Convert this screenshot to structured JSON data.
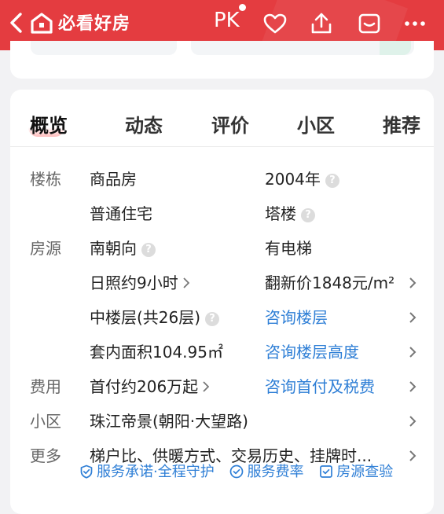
{
  "header": {
    "brand": "必看好房",
    "pk": "PK",
    "bg_color": "#e43c40",
    "icons": [
      "back-arrow-icon",
      "logo-house-icon",
      "heart-icon",
      "share-icon",
      "message-box-icon",
      "more-icon"
    ]
  },
  "tabs": [
    {
      "label": "概览",
      "active": true
    },
    {
      "label": "动态"
    },
    {
      "label": "评价"
    },
    {
      "label": "小区"
    },
    {
      "label": "推荐"
    }
  ],
  "rows": {
    "building_type": {
      "cat": "楼栋",
      "v1": "商品房",
      "v2": "2004年"
    },
    "building_usage": {
      "v1": "普通住宅",
      "v2": "塔楼"
    },
    "orientation": {
      "cat": "房源",
      "v1": "南朝向",
      "v2": "有电梯"
    },
    "sunlight": {
      "v1": "日照约9小时",
      "v2": "翻新价1848元/m²"
    },
    "floor": {
      "v1": "中楼层(共26层)",
      "v2": "咨询楼层"
    },
    "area": {
      "v1": "套内面积104.95㎡",
      "v2": "咨询楼层高度"
    },
    "fees": {
      "cat": "费用",
      "v1": "首付约206万起",
      "v2": "咨询首付及税费"
    },
    "community": {
      "cat": "小区",
      "v1": "珠江帝景(朝阳·大望路)"
    },
    "more": {
      "cat": "更多",
      "v1": "梯户比、供暖方式、交易历史、挂牌时..."
    }
  },
  "badges": [
    {
      "icon": "shield-check-icon",
      "label": "服务承诺·全程守护"
    },
    {
      "icon": "circle-check-icon",
      "label": "服务费率"
    },
    {
      "icon": "square-check-icon",
      "label": "房源查验"
    }
  ],
  "colors": {
    "link": "#2f7fd6",
    "label": "#666666",
    "text": "#222222"
  }
}
